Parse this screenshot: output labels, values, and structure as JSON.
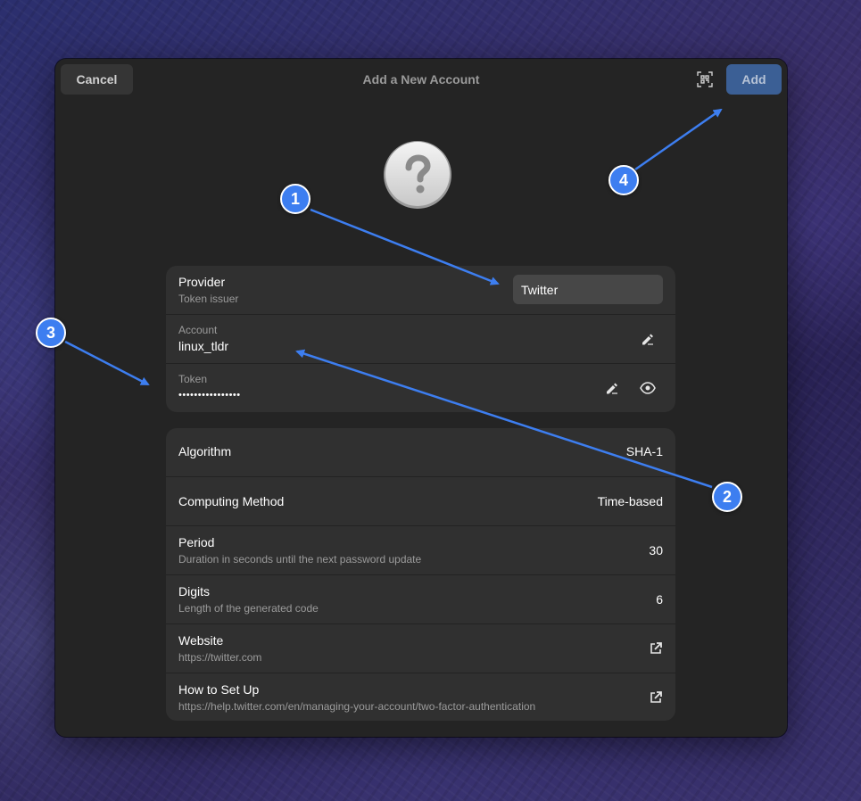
{
  "headerbar": {
    "cancel_label": "Cancel",
    "title": "Add a New Account",
    "scan_icon": "qr-scan-icon",
    "add_label": "Add"
  },
  "provider_image": {
    "icon": "question-mark-icon"
  },
  "account_card": {
    "provider": {
      "label": "Provider",
      "subtitle": "Token issuer",
      "value": "Twitter"
    },
    "account": {
      "label": "Account",
      "value": "linux_tldr",
      "icon": "edit-icon"
    },
    "token": {
      "label": "Token",
      "value": "••••••••••••••••",
      "icons": [
        "edit-icon",
        "eye-icon"
      ]
    }
  },
  "details_card": {
    "algorithm": {
      "label": "Algorithm",
      "value": "SHA-1"
    },
    "computing_method": {
      "label": "Computing Method",
      "value": "Time-based"
    },
    "period": {
      "label": "Period",
      "subtitle": "Duration in seconds until the next password update",
      "value": "30"
    },
    "digits": {
      "label": "Digits",
      "subtitle": "Length of the generated code",
      "value": "6"
    },
    "website": {
      "label": "Website",
      "subtitle": "https://twitter.com",
      "icon": "external-link-icon"
    },
    "how_to": {
      "label": "How to Set Up",
      "subtitle": "https://help.twitter.com/en/managing-your-account/two-factor-authentication",
      "icon": "external-link-icon"
    }
  },
  "annotations": {
    "markers": [
      "1",
      "2",
      "3",
      "4"
    ],
    "color": "#3d7ef0"
  },
  "colors": {
    "dialog_bg": "#242424",
    "card_bg": "#303030",
    "accent": "#3b5f95"
  }
}
